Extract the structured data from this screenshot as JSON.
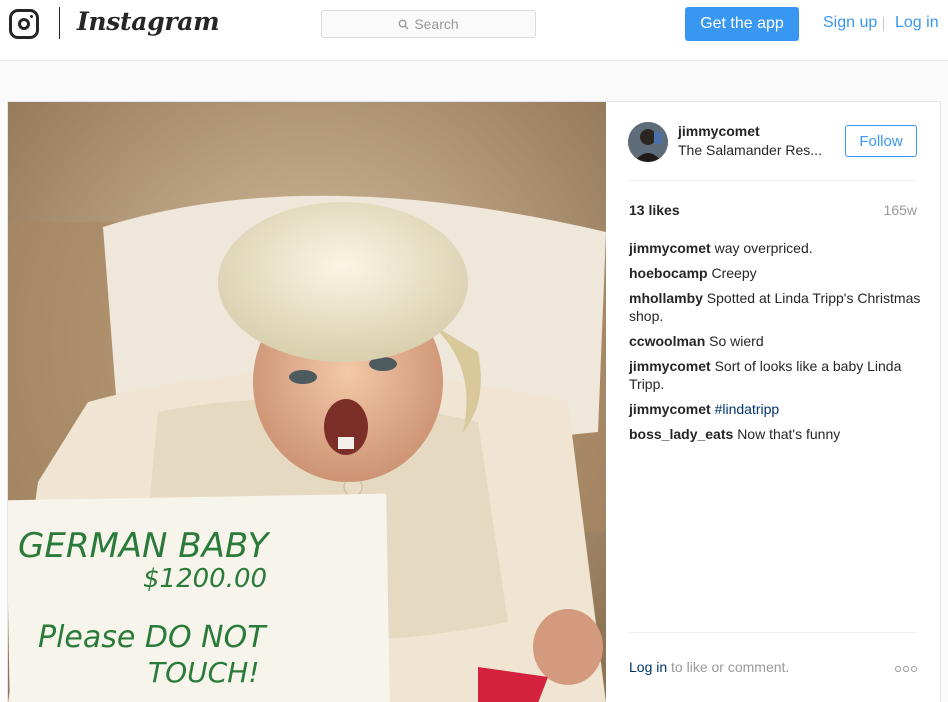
{
  "nav": {
    "brand": "Instagram",
    "search_placeholder": "Search",
    "get_app_label": "Get the app",
    "signup_label": "Sign up",
    "login_label": "Log in"
  },
  "post": {
    "image": {
      "sign_line1": "GERMAN BABY",
      "sign_line2": "$1200.00",
      "sign_line3": "Please DO NOT",
      "sign_line4": "TOUCH!"
    },
    "author": {
      "username": "jimmycomet",
      "location": "The Salamander Res..."
    },
    "follow_label": "Follow",
    "likes": "13 likes",
    "age": "165w",
    "comments": [
      {
        "user": "jimmycomet",
        "text": "way overpriced."
      },
      {
        "user": "hoebocamp",
        "text": "Creepy"
      },
      {
        "user": "mhollamby",
        "text": "Spotted at Linda Tripp's Christmas shop."
      },
      {
        "user": "ccwoolman",
        "text": "So wierd"
      },
      {
        "user": "jimmycomet",
        "text": "Sort of looks like a baby Linda Tripp."
      },
      {
        "user": "jimmycomet",
        "text": "#lindatripp"
      },
      {
        "user": "boss_lady_eats",
        "text": "Now that's funny"
      }
    ],
    "footer": {
      "login_link": "Log in",
      "login_text": " to like or comment."
    }
  },
  "colors": {
    "accent": "#3897f0",
    "link_dark": "#003569",
    "muted": "#999999"
  },
  "icons": [
    "instagram-glyph-icon",
    "search-icon",
    "more-options-icon"
  ]
}
